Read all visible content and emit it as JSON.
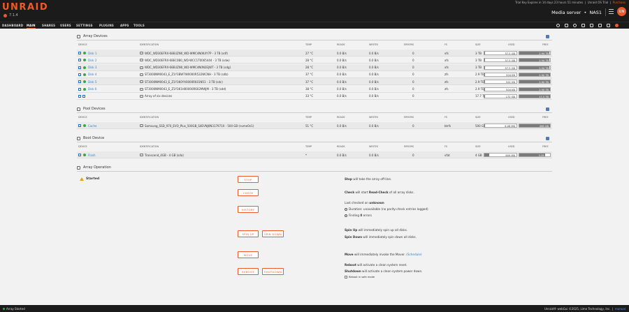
{
  "header": {
    "logo": "UNRAID",
    "version": "7.1.4",
    "trial_text": "Trial Key Expires in 14 days 23 hours 51 minutes",
    "trial_sep": "Unraid OS Trial",
    "purchase": "Purchase",
    "server_desc": "Media server",
    "server_name": "NAS1",
    "avatar_initials": "UN"
  },
  "nav": {
    "items": [
      "DASHBOARD",
      "MAIN",
      "SHARES",
      "USERS",
      "SETTINGS",
      "PLUGINS",
      "APPS",
      "TOOLS"
    ],
    "active": "MAIN"
  },
  "columns": {
    "device": "DEVICE",
    "identification": "IDENTIFICATION",
    "temp": "TEMP",
    "reads": "READS",
    "writes": "WRITES",
    "errors": "ERRORS",
    "fs": "FS",
    "size": "SIZE",
    "used": "USED",
    "free": "FREE"
  },
  "array": {
    "title": "Array Devices",
    "rows": [
      {
        "name": "Disk 1",
        "id": "WDC_WD30EFRX-68EUZN0_WD-WMC4N0K4Y7P - 3 TB (sdf)",
        "temp": "27 °C",
        "reads": "0.0 B/s",
        "writes": "0.0 B/s",
        "errors": "0",
        "fs": "xfs",
        "size": "3 TB",
        "used": "57.5 GB",
        "free": "2.94 TB",
        "used_frac": 0.02
      },
      {
        "name": "Disk 2",
        "id": "WDC_WD30EFRX-68EC0B0_WD-WCC1T0065444 - 3 TB (sdw)",
        "temp": "28 °C",
        "reads": "0.0 B/s",
        "writes": "0.0 B/s",
        "errors": "0",
        "fs": "xfs",
        "size": "3 TB",
        "used": "57.5 GB",
        "free": "2.94 TB",
        "used_frac": 0.02
      },
      {
        "name": "Disk 3",
        "id": "WDC_WD30EFRX-68EUZN0_WD-WMC4N0N2EJWT - 3 TB (sdg)",
        "temp": "28 °C",
        "reads": "0.0 B/s",
        "writes": "0.0 B/s",
        "errors": "0",
        "fs": "xfs",
        "size": "3 TB",
        "used": "57.5 GB",
        "free": "2.94 TB",
        "used_frac": 0.02
      },
      {
        "name": "Disk 4",
        "id": "ST3000NM0043_E_Z1Y3BW7W0000R532WCNH - 3 TB (sdb)",
        "temp": "37 °C",
        "reads": "0.0 B/s",
        "writes": "0.0 B/s",
        "errors": "0",
        "fs": "zfs",
        "size": "2.9 TB",
        "used": "504 KB",
        "free": "2.90 TB",
        "used_frac": 0.0
      },
      {
        "name": "Disk 5",
        "id": "ST3000NM0043_E_Z1Y3K0YX0000R601N51 - 3 TB (sdc)",
        "temp": "37 °C",
        "reads": "0.0 B/s",
        "writes": "0.0 B/s",
        "errors": "0",
        "fs": "zfs",
        "size": "2.9 TB",
        "used": "541 KB",
        "free": "2.90 TB",
        "used_frac": 0.0
      },
      {
        "name": "Disk 6",
        "id": "ST3000NM0043_E_Z1Y3K1H00000R602MWJM - 3 TB (sdd)",
        "temp": "38 °C",
        "reads": "0.0 B/s",
        "writes": "0.0 B/s",
        "errors": "0",
        "fs": "zfs",
        "size": "2.9 TB",
        "used": "504 KB",
        "free": "2.90 TB",
        "used_frac": 0.0
      }
    ],
    "summary": {
      "id": "Array of six devices",
      "temp": "33 °C",
      "reads": "0.0 B/s",
      "writes": "0.0 B/s",
      "errors": "0",
      "size": "17.7 TB",
      "used": "172 GB",
      "free": "17.5 TB",
      "used_frac": 0.01
    }
  },
  "pool": {
    "title": "Pool Devices",
    "rows": [
      {
        "name": "Cache",
        "id": "Samsung_SSD_970_EVO_Plus_500GB_S4EVNJ0N317971X - 500 GB (nvme0n1)",
        "temp": "51 °C",
        "reads": "0.0 B/s",
        "writes": "0.0 B/s",
        "errors": "0",
        "fs": "btrfs",
        "size": "500 GB",
        "used": "6.06 MB",
        "free": "498 GB",
        "used_frac": 0.0
      }
    ]
  },
  "boot": {
    "title": "Boot Device",
    "rows": [
      {
        "name": "Flash",
        "id": "Transcend_4GB - 4 GB (sda)",
        "temp": "*",
        "reads": "0.0 B/s",
        "writes": "0.0 B/s",
        "errors": "0",
        "fs": "vfat",
        "size": "4 GB",
        "used": "609 MB",
        "free": "3.39 GB",
        "used_frac": 0.15
      }
    ]
  },
  "operation": {
    "title": "Array Operation",
    "status": "Started",
    "buttons": {
      "stop": "STOP",
      "check": "CHECK",
      "history": "HISTORY",
      "spin_up": "SPIN UP",
      "spin_down": "SPIN DOWN",
      "move": "MOVE",
      "reboot": "REBOOT",
      "shutdown": "SHUTDOWN"
    },
    "desc": {
      "stop_b": "Stop",
      "stop_t": " will take the array off-line.",
      "check_b": "Check",
      "check_t": " will start ",
      "check_b2": "Read-Check",
      "check_t2": " of all array disks.",
      "last_checked": "Last checked on ",
      "last_checked_b": "unknown",
      "duration": "Duration: unavailable (no parity-check entries logged)",
      "finding": "Finding ",
      "finding_b": "0",
      "finding_t": " errors",
      "spinup_b": "Spin Up",
      "spinup_t": " will immediately spin up all disks.",
      "spindown_b": "Spin Down",
      "spindown_t": " will immediately spin down all disks.",
      "move_b": "Move",
      "move_t": " will immediately invoke the Mover. ",
      "move_link": "(Schedule)",
      "reboot_b": "Reboot",
      "reboot_t": " will activate a clean system reset.",
      "shutdown_b": "Shutdown",
      "shutdown_t": " will activate a clean system power down.",
      "safe_mode": "Reboot in safe mode"
    }
  },
  "footer": {
    "status": "Array Started",
    "copyright": "Unraid® webGui ©2025, Lime Technology, Inc.",
    "manual": "manual"
  },
  "colors": {
    "accent": "#ef5a2a",
    "ok": "#3aa641",
    "link": "#2f7ec4"
  }
}
